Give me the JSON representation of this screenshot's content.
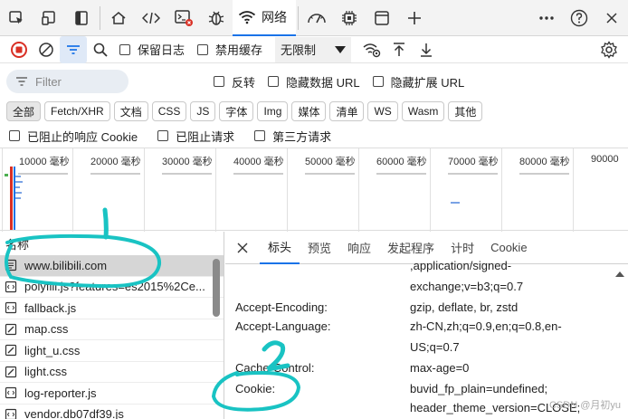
{
  "tabbar": {
    "icons": [
      "inspect-icon",
      "device-icon",
      "sidebar-toggle-icon",
      "home-icon",
      "sources-code-icon",
      "console-icon",
      "debug-bug-icon"
    ],
    "active_tab": "网络",
    "more_icons": [
      "performance-icon",
      "memory-chip-icon",
      "application-icon",
      "add-tab-icon",
      "more-icon",
      "help-icon"
    ]
  },
  "toolbar": {
    "preserve_log": "保留日志",
    "disable_cache": "禁用缓存",
    "throttle": "无限制"
  },
  "filter": {
    "placeholder": "Filter",
    "invert": "反转",
    "hide_data_url": "隐藏数据 URL",
    "hide_ext_url": "隐藏扩展 URL"
  },
  "types": [
    "全部",
    "Fetch/XHR",
    "文档",
    "CSS",
    "JS",
    "字体",
    "Img",
    "媒体",
    "清单",
    "WS",
    "Wasm",
    "其他"
  ],
  "blocked": {
    "blocked_cookies": "已阻止的响应 Cookie",
    "blocked_requests": "已阻止请求",
    "third_party": "第三方请求"
  },
  "timeline": {
    "ticks": [
      "10000 毫秒",
      "20000 毫秒",
      "30000 毫秒",
      "40000 毫秒",
      "50000 毫秒",
      "60000 毫秒",
      "70000 毫秒",
      "80000 毫秒",
      "90000"
    ]
  },
  "requests": {
    "header": "名称",
    "items": [
      {
        "name": "www.bilibili.com"
      },
      {
        "name": "polyfill.js?features=es2015%2Ce..."
      },
      {
        "name": "fallback.js"
      },
      {
        "name": "map.css"
      },
      {
        "name": "light_u.css"
      },
      {
        "name": "light.css"
      },
      {
        "name": "log-reporter.js"
      },
      {
        "name": "vendor.db07df39.js"
      }
    ]
  },
  "details": {
    "tabs": [
      "标头",
      "预览",
      "响应",
      "发起程序",
      "计时",
      "Cookie"
    ],
    "accept_tail_1": ",application/signed-",
    "accept_tail_2": "exchange;v=b3;q=0.7",
    "rows": [
      {
        "name": "Accept-Encoding:",
        "value": "gzip, deflate, br, zstd"
      },
      {
        "name": "Accept-Language:",
        "value": "zh-CN,zh;q=0.9,en;q=0.8,en-"
      },
      {
        "name": "",
        "value": "US;q=0.7"
      },
      {
        "name": "Cache-Control:",
        "value": "max-age=0"
      },
      {
        "name": "Cookie:",
        "value": "buvid_fp_plain=undefined;"
      },
      {
        "name": "",
        "value": "header_theme_version=CLOSE;"
      }
    ]
  },
  "annotations": {
    "one": "1",
    "two": "2"
  },
  "watermark": "CSDN @月初yu",
  "colors": {
    "accent": "#1a73e8",
    "record": "#d93025",
    "annotation": "#19c3c3"
  }
}
